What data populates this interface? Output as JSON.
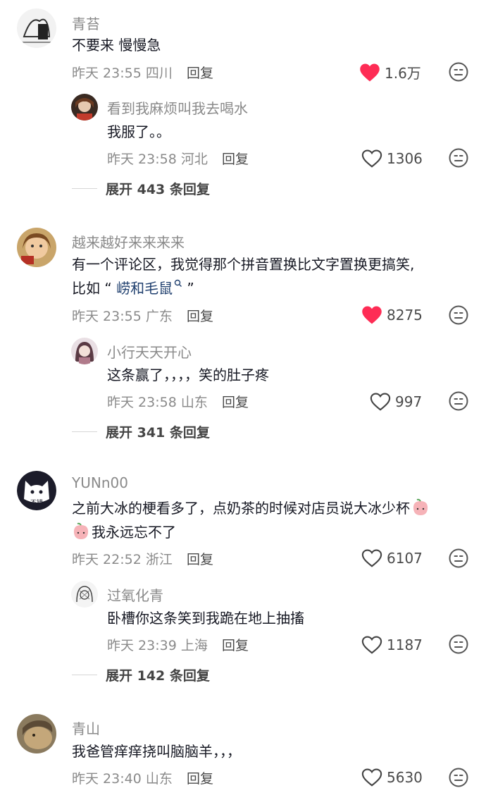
{
  "comments": [
    {
      "name": "青苔",
      "text": "不要来 慢慢急",
      "time": "昨天 23:55 四川",
      "reply": "回复",
      "likes": "1.6万",
      "liked": true,
      "sub": {
        "name": "看到我麻烦叫我去喝水",
        "text": "我服了。。",
        "time": "昨天 23:58 河北",
        "reply": "回复",
        "likes": "1306",
        "liked": false
      },
      "expand": "展开 443 条回复"
    },
    {
      "name": "越来越好来来来来",
      "text1": "有一个评论区，我觉得那个拼音置换比文字置换更搞笑,",
      "text2a": "比如 “ ",
      "text2b": "崂和毛鼠",
      "text2c": " ”",
      "time": "昨天 23:55 广东",
      "reply": "回复",
      "likes": "8275",
      "liked": true,
      "sub": {
        "name": "小行天天开心",
        "text": "这条赢了，，，，笑的肚子疼",
        "time": "昨天 23:58 山东",
        "reply": "回复",
        "likes": "997",
        "liked": false
      },
      "expand": "展开 341 条回复"
    },
    {
      "name": "YUNn00",
      "text1": "之前大冰的梗看多了，点奶茶的时候对店员说大冰少杯",
      "text2": "我永远忘不了",
      "avatar_text": "不错",
      "time": "昨天 22:52 浙江",
      "reply": "回复",
      "likes": "6107",
      "liked": false,
      "sub": {
        "name": "过氧化青",
        "text": "卧槽你这条笑到我跪在地上抽搐",
        "time": "昨天 23:39 上海",
        "reply": "回复",
        "likes": "1187",
        "liked": false
      },
      "expand": "展开 142 条回复"
    },
    {
      "name": "青山",
      "text": "我爸管痒痒挠叫脑脑羊，，，",
      "time": "昨天 23:40 山东",
      "reply": "回复",
      "likes": "5630",
      "liked": false
    }
  ],
  "colors": {
    "liked": "#fe2c55",
    "muted": "#8a8a8a",
    "text": "#161823",
    "link": "#1f3f6e"
  },
  "icons": {
    "heart": "heart-icon",
    "search": "search-icon",
    "dislike": "meh-face-icon",
    "emoji": "peach-emoji-icon"
  }
}
